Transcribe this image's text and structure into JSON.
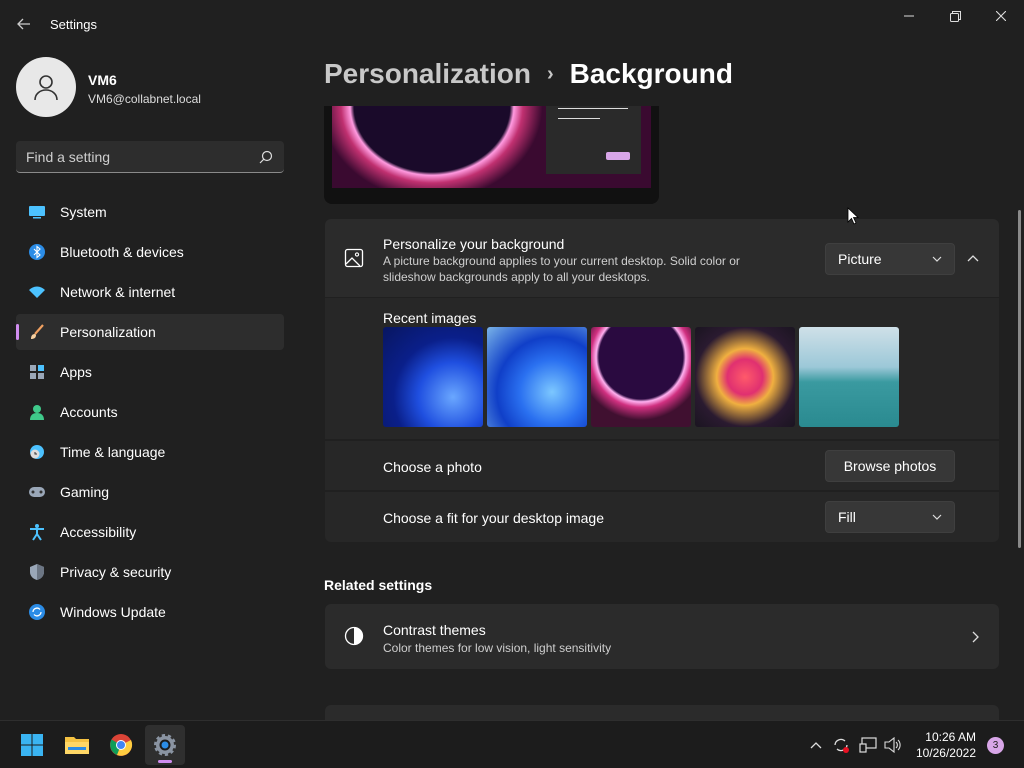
{
  "window": {
    "title": "Settings"
  },
  "profile": {
    "name": "VM6",
    "email": "VM6@collabnet.local"
  },
  "search": {
    "placeholder": "Find a setting"
  },
  "nav": {
    "items": [
      {
        "label": "System",
        "icon": "monitor-icon"
      },
      {
        "label": "Bluetooth & devices",
        "icon": "bluetooth-icon"
      },
      {
        "label": "Network & internet",
        "icon": "wifi-icon"
      },
      {
        "label": "Personalization",
        "icon": "brush-icon",
        "active": true
      },
      {
        "label": "Apps",
        "icon": "apps-icon"
      },
      {
        "label": "Accounts",
        "icon": "person-icon"
      },
      {
        "label": "Time & language",
        "icon": "globe-clock-icon"
      },
      {
        "label": "Gaming",
        "icon": "gamepad-icon"
      },
      {
        "label": "Accessibility",
        "icon": "accessibility-icon"
      },
      {
        "label": "Privacy & security",
        "icon": "shield-icon"
      },
      {
        "label": "Windows Update",
        "icon": "update-icon"
      }
    ]
  },
  "breadcrumb": {
    "parent": "Personalization",
    "separator": "›",
    "current": "Background"
  },
  "personalize": {
    "title": "Personalize your background",
    "description": "A picture background applies to your current desktop. Solid color or slideshow backgrounds apply to all your desktops.",
    "dropdown_value": "Picture"
  },
  "recent_images": {
    "label": "Recent images",
    "count": 5
  },
  "choose_photo": {
    "label": "Choose a photo",
    "button": "Browse photos"
  },
  "choose_fit": {
    "label": "Choose a fit for your desktop image",
    "dropdown_value": "Fill"
  },
  "related": {
    "title": "Related settings",
    "items": [
      {
        "title": "Contrast themes",
        "description": "Color themes for low vision, light sensitivity"
      }
    ]
  },
  "taskbar": {
    "apps": [
      "start-icon",
      "file-explorer-icon",
      "chrome-icon",
      "settings-icon"
    ],
    "time": "10:26 AM",
    "date": "10/26/2022",
    "notifications": "3"
  },
  "colors": {
    "accent": "#d08df0",
    "background": "#202020",
    "card": "#2b2b2b"
  }
}
